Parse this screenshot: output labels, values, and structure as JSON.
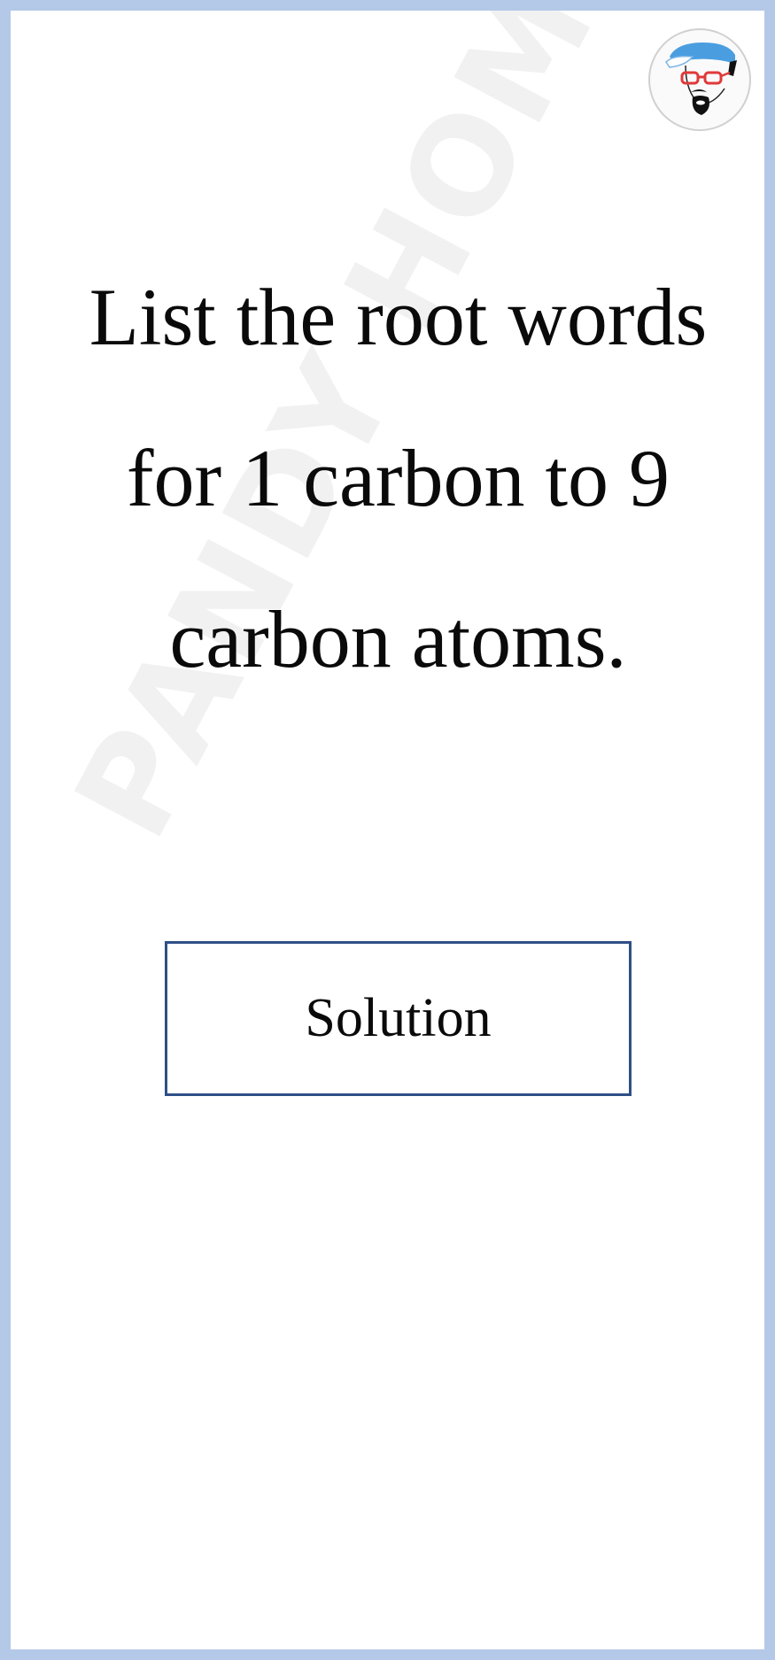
{
  "question": {
    "text": "List the root words for 1 carbon to 9 carbon atoms."
  },
  "solution_button": {
    "label": "Solution"
  },
  "watermark": {
    "text": "PANDY HOMAYA"
  },
  "avatar": {
    "icon": "cartoon-avatar-icon"
  },
  "colors": {
    "frame_border": "#b4c8e8",
    "button_border": "#2f4f87",
    "text": "#0a0a0a",
    "cap_blue": "#4a9ee0",
    "glasses_red": "#e03a3a"
  }
}
